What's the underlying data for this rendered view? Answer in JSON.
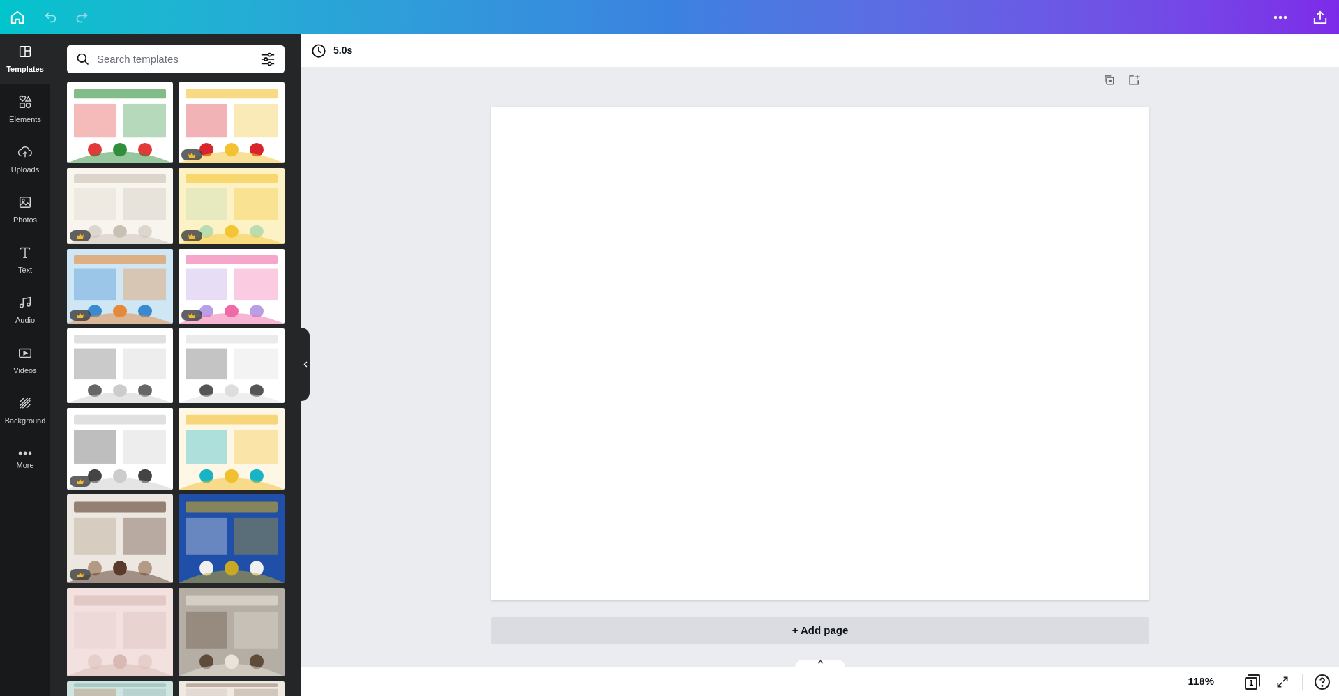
{
  "rail": [
    {
      "label": "Templates",
      "selected": true
    },
    {
      "label": "Elements",
      "selected": false
    },
    {
      "label": "Uploads",
      "selected": false
    },
    {
      "label": "Photos",
      "selected": false
    },
    {
      "label": "Text",
      "selected": false
    },
    {
      "label": "Audio",
      "selected": false
    },
    {
      "label": "Videos",
      "selected": false
    },
    {
      "label": "Background",
      "selected": false
    },
    {
      "label": "More",
      "selected": false
    }
  ],
  "search": {
    "placeholder": "Search templates"
  },
  "templates": [
    {
      "kind": "picture",
      "premium": false
    },
    {
      "kind": "picture",
      "premium": true
    },
    {
      "kind": "picture",
      "premium": true
    },
    {
      "kind": "picture",
      "premium": true
    },
    {
      "kind": "picture",
      "premium": true
    },
    {
      "kind": "picture",
      "premium": true
    },
    {
      "kind": "picture",
      "premium": false
    },
    {
      "kind": "picture",
      "premium": false
    },
    {
      "kind": "picture",
      "premium": true
    },
    {
      "kind": "picture",
      "premium": false
    },
    {
      "kind": "picture",
      "premium": true
    },
    {
      "kind": "picture",
      "premium": false
    },
    {
      "kind": "picture",
      "premium": false
    },
    {
      "kind": "picture",
      "premium": false
    },
    {
      "kind": "picture",
      "premium": false
    },
    {
      "kind": "picture",
      "premium": false
    }
  ],
  "toolbar": {
    "duration": "5.0s"
  },
  "add_page": "+ Add page",
  "footer": {
    "zoom": "118%",
    "page_count": "1"
  }
}
